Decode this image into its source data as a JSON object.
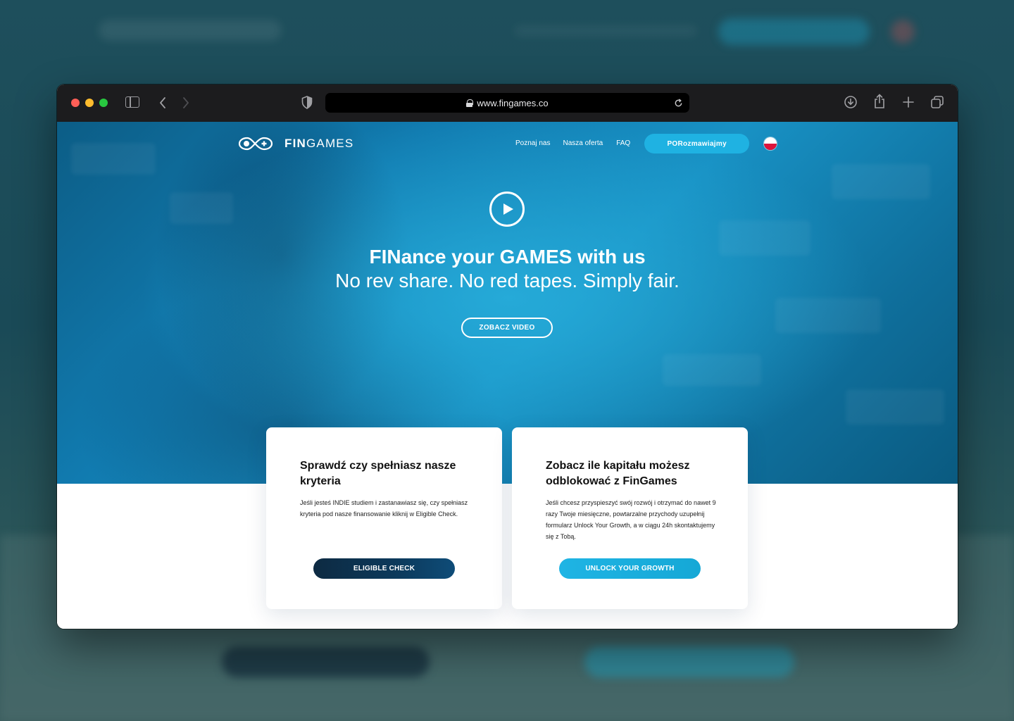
{
  "browser": {
    "url": "www.fingames.co"
  },
  "site": {
    "logo": {
      "bold": "FIN",
      "light": "GAMES"
    },
    "nav": {
      "items": [
        "Poznaj nas",
        "Nasza oferta",
        "FAQ"
      ],
      "cta": "PORozmawiajmy"
    },
    "hero": {
      "headline": "FINance your GAMES with us",
      "subline": "No rev share. No red tapes. Simply fair.",
      "video_button": "ZOBACZ VIDEO"
    },
    "cards": [
      {
        "title": "Sprawdź czy spełniasz nasze kryteria",
        "body": "Jeśli jesteś INDIE studiem i zastanawiasz się, czy spełniasz kryteria pod nasze finansowanie kliknij w Eligible Check.",
        "button": "ELIGIBLE CHECK"
      },
      {
        "title": "Zobacz ile kapitału możesz odblokować z FinGames",
        "body": "Jeśli chcesz przyspieszyć swój rozwój i otrzymać do nawet 9 razy Twoje miesięczne, powtarzalne przychody uzupełnij formularz Unlock Your Growth, a w ciągu 24h skontaktujemy się z Tobą.",
        "button": "UNLOCK YOUR GROWTH"
      }
    ]
  },
  "colors": {
    "accent": "#1fb2e2",
    "dark_button": "#0d2a42",
    "hero": "#1891c4"
  }
}
